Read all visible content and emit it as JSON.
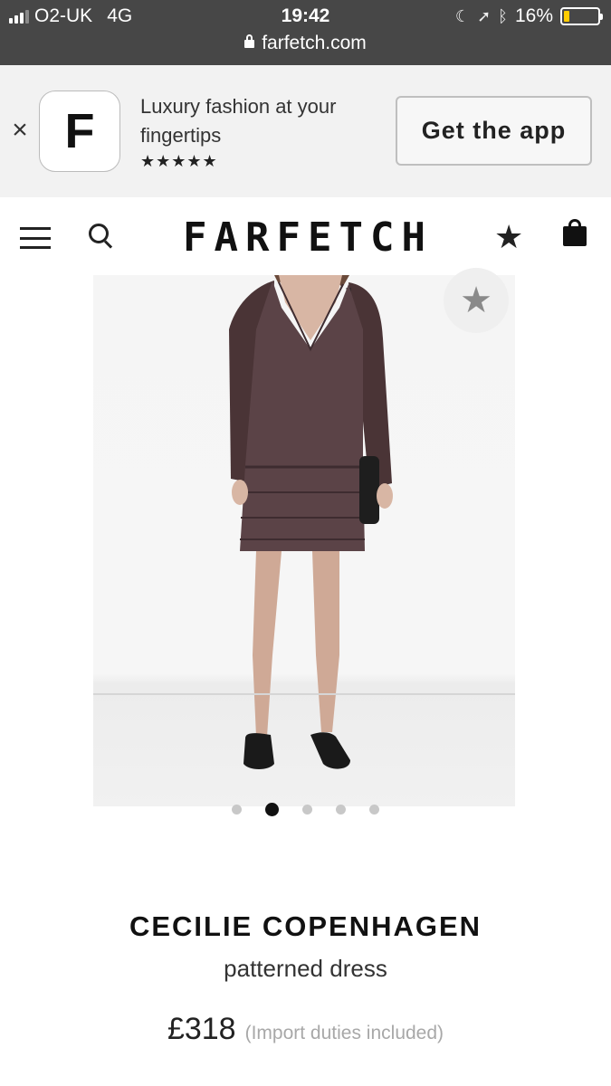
{
  "status_bar": {
    "carrier": "O2-UK",
    "network": "4G",
    "time": "19:42",
    "battery_percent": "16%",
    "battery_level": 0.16,
    "battery_color": "#ffcc00",
    "url": "farfetch.com",
    "icons": [
      "signal-icon",
      "moon-icon",
      "location-arrow-icon",
      "bluetooth-icon",
      "battery-icon",
      "lock-icon"
    ]
  },
  "app_banner": {
    "close_symbol": "×",
    "app_icon_letter": "F",
    "tagline": "Luxury fashion at your fingertips",
    "rating": "★★★★★",
    "cta_label": "Get the app"
  },
  "header": {
    "logo": "FARFETCH",
    "wishlist_symbol": "★",
    "icons": [
      "menu-icon",
      "search-icon",
      "wishlist-star-icon",
      "shopping-bag-icon"
    ]
  },
  "product": {
    "favorite_symbol": "★",
    "carousel": {
      "total": 5,
      "active_index": 2
    },
    "brand": "CECILIE COPENHAGEN",
    "name": "patterned dress",
    "price": "£318",
    "duty_note": "(Import duties included)"
  },
  "colors": {
    "status_bar_bg": "#474747",
    "banner_bg": "#f2f2f2",
    "dress": "#5b4347"
  }
}
